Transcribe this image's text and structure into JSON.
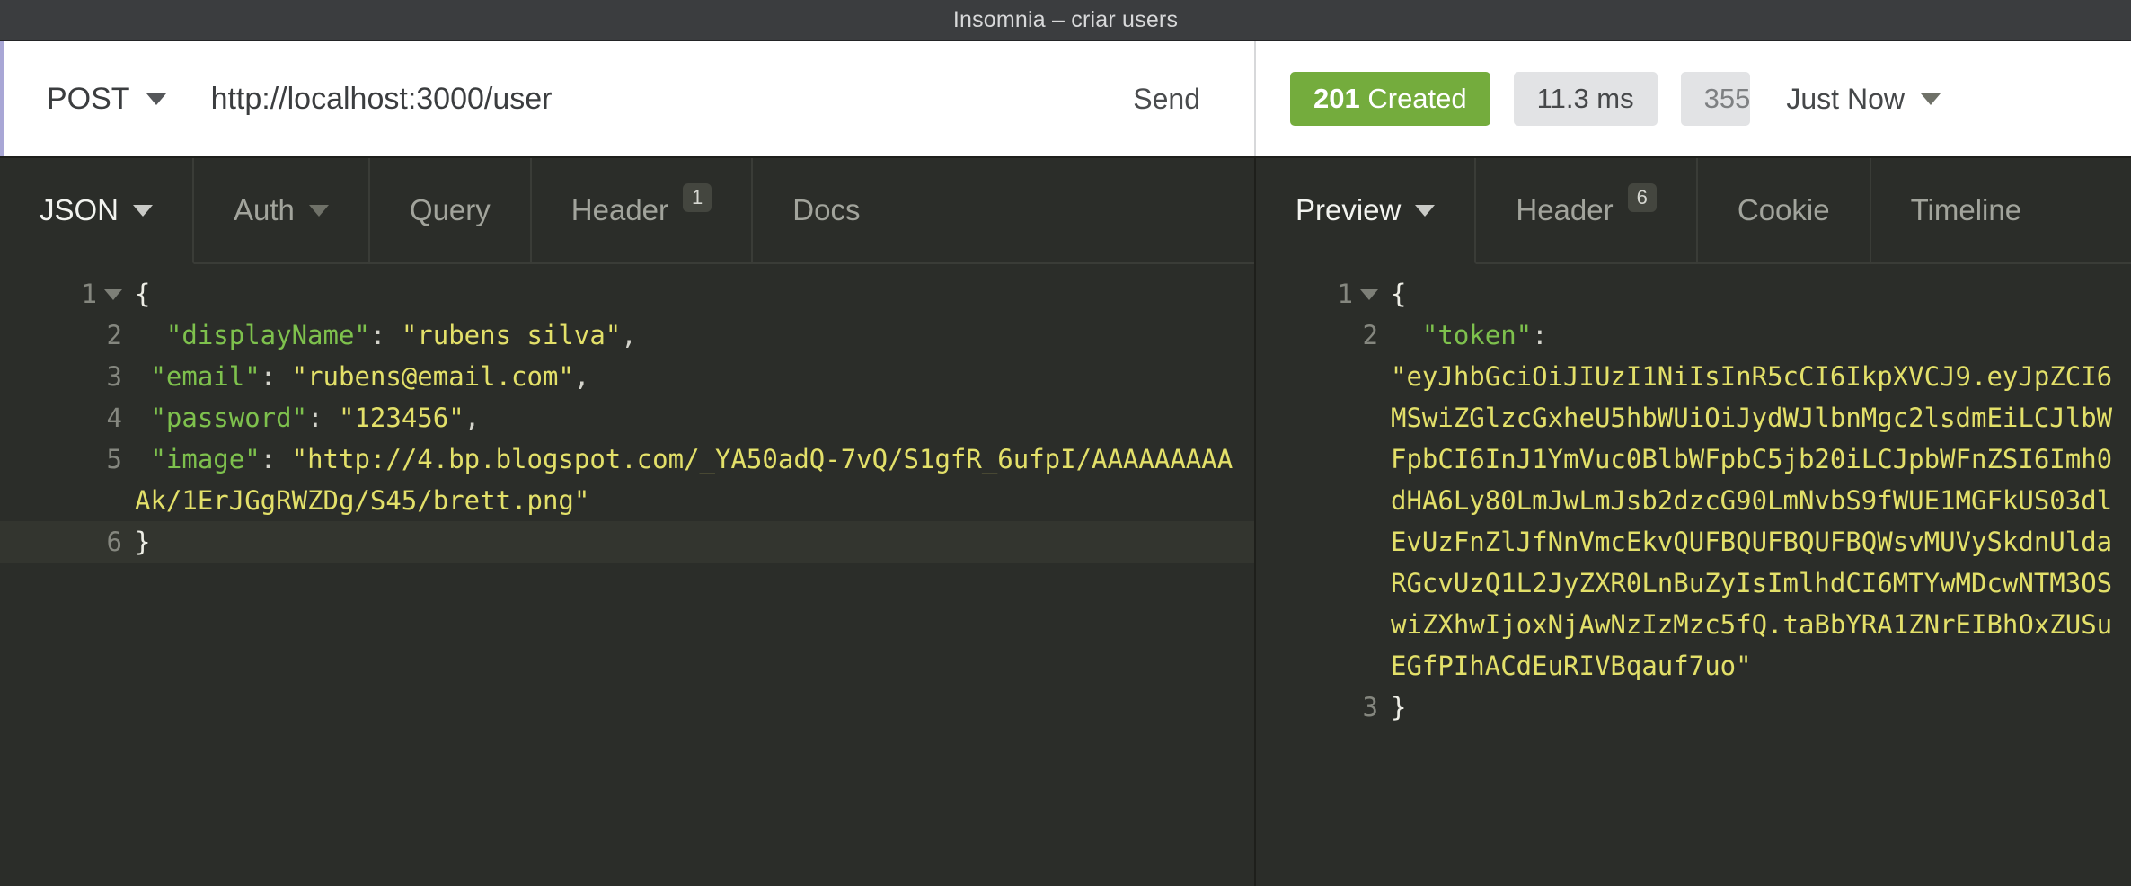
{
  "window": {
    "title": "Insomnia – criar users"
  },
  "request_bar": {
    "method": "POST",
    "method_caret_icon": "chevron-down-icon",
    "url": "http://localhost:3000/user",
    "send_label": "Send"
  },
  "response_meta": {
    "status_code": "201",
    "status_text": "Created",
    "time": "11.3 ms",
    "size": "355",
    "history_label": "Just Now",
    "history_caret_icon": "chevron-down-icon",
    "status_color": "#74ac3d"
  },
  "request_tabs": [
    {
      "label": "JSON",
      "active": true,
      "caret": true,
      "badge": null
    },
    {
      "label": "Auth",
      "active": false,
      "caret": true,
      "badge": null
    },
    {
      "label": "Query",
      "active": false,
      "caret": false,
      "badge": null
    },
    {
      "label": "Header",
      "active": false,
      "caret": false,
      "badge": "1"
    },
    {
      "label": "Docs",
      "active": false,
      "caret": false,
      "badge": null
    }
  ],
  "response_tabs": [
    {
      "label": "Preview",
      "active": true,
      "caret": true,
      "badge": null
    },
    {
      "label": "Header",
      "active": false,
      "caret": false,
      "badge": "6"
    },
    {
      "label": "Cookie",
      "active": false,
      "caret": false,
      "badge": null
    },
    {
      "label": "Timeline",
      "active": false,
      "caret": false,
      "badge": null
    }
  ],
  "request_body": {
    "language": "json",
    "lines": [
      {
        "num": "1",
        "fold": true,
        "highlight": false,
        "tokens": [
          {
            "t": "{",
            "c": "b"
          }
        ]
      },
      {
        "num": "2",
        "fold": false,
        "highlight": false,
        "tokens": [
          {
            "t": "  ",
            "c": "p"
          },
          {
            "t": "\"displayName\"",
            "c": "k"
          },
          {
            "t": ": ",
            "c": "p"
          },
          {
            "t": "\"rubens silva\"",
            "c": "s"
          },
          {
            "t": ",",
            "c": "p"
          }
        ]
      },
      {
        "num": "3",
        "fold": false,
        "highlight": false,
        "tokens": [
          {
            "t": " ",
            "c": "p"
          },
          {
            "t": "\"email\"",
            "c": "k"
          },
          {
            "t": ": ",
            "c": "p"
          },
          {
            "t": "\"rubens@email.com\"",
            "c": "s"
          },
          {
            "t": ",",
            "c": "p"
          }
        ]
      },
      {
        "num": "4",
        "fold": false,
        "highlight": false,
        "tokens": [
          {
            "t": " ",
            "c": "p"
          },
          {
            "t": "\"password\"",
            "c": "k"
          },
          {
            "t": ": ",
            "c": "p"
          },
          {
            "t": "\"123456\"",
            "c": "s"
          },
          {
            "t": ",",
            "c": "p"
          }
        ]
      },
      {
        "num": "5",
        "fold": false,
        "highlight": false,
        "tokens": [
          {
            "t": " ",
            "c": "p"
          },
          {
            "t": "\"image\"",
            "c": "k"
          },
          {
            "t": ": ",
            "c": "p"
          },
          {
            "t": "\"http://4.bp.blogspot.com/_YA50adQ-7vQ/S1gfR_6ufpI/AAAAAAAAAAk/1ErJGgRWZDg/S45/brett.png\"",
            "c": "s"
          }
        ]
      },
      {
        "num": "6",
        "fold": false,
        "highlight": true,
        "tokens": [
          {
            "t": "}",
            "c": "b"
          }
        ]
      }
    ]
  },
  "response_body": {
    "language": "json",
    "lines": [
      {
        "num": "1",
        "fold": true,
        "highlight": false,
        "tokens": [
          {
            "t": "{",
            "c": "b"
          }
        ]
      },
      {
        "num": "2",
        "fold": false,
        "highlight": false,
        "tokens": [
          {
            "t": "  ",
            "c": "p"
          },
          {
            "t": "\"token\"",
            "c": "k"
          },
          {
            "t": ":",
            "c": "p"
          },
          {
            "t": "\n",
            "c": "p"
          },
          {
            "t": "\"eyJhbGciOiJIUzI1NiIsInR5cCI6IkpXVCJ9.eyJpZCI6MSwiZGlzcGxheU5hbWUiOiJydWJlbnMgc2lsdmEiLCJlbWFpbCI6InJ1YmVuc0BlbWFpbC5jb20iLCJpbWFnZSI6Imh0dHA6Ly80LmJwLmJsb2dzcG90LmNvbS9fWUE1MGFkUS03dlEvUzFnZlJfNnVmcEkvQUFBQUFBQUFBQWsvMUVySkdnUldaRGcvUzQ1L2JyZXR0LnBuZyIsImlhdCI6MTYwMDcwNTM3OSwiZXhwIjoxNjAwNzIzMzc5fQ.taBbYRA1ZNrEIBhOxZUSuEGfPIhACdEuRIVBqauf7uo\"",
            "c": "s"
          }
        ]
      },
      {
        "num": "3",
        "fold": false,
        "highlight": false,
        "tokens": [
          {
            "t": "}",
            "c": "b"
          }
        ]
      }
    ]
  }
}
